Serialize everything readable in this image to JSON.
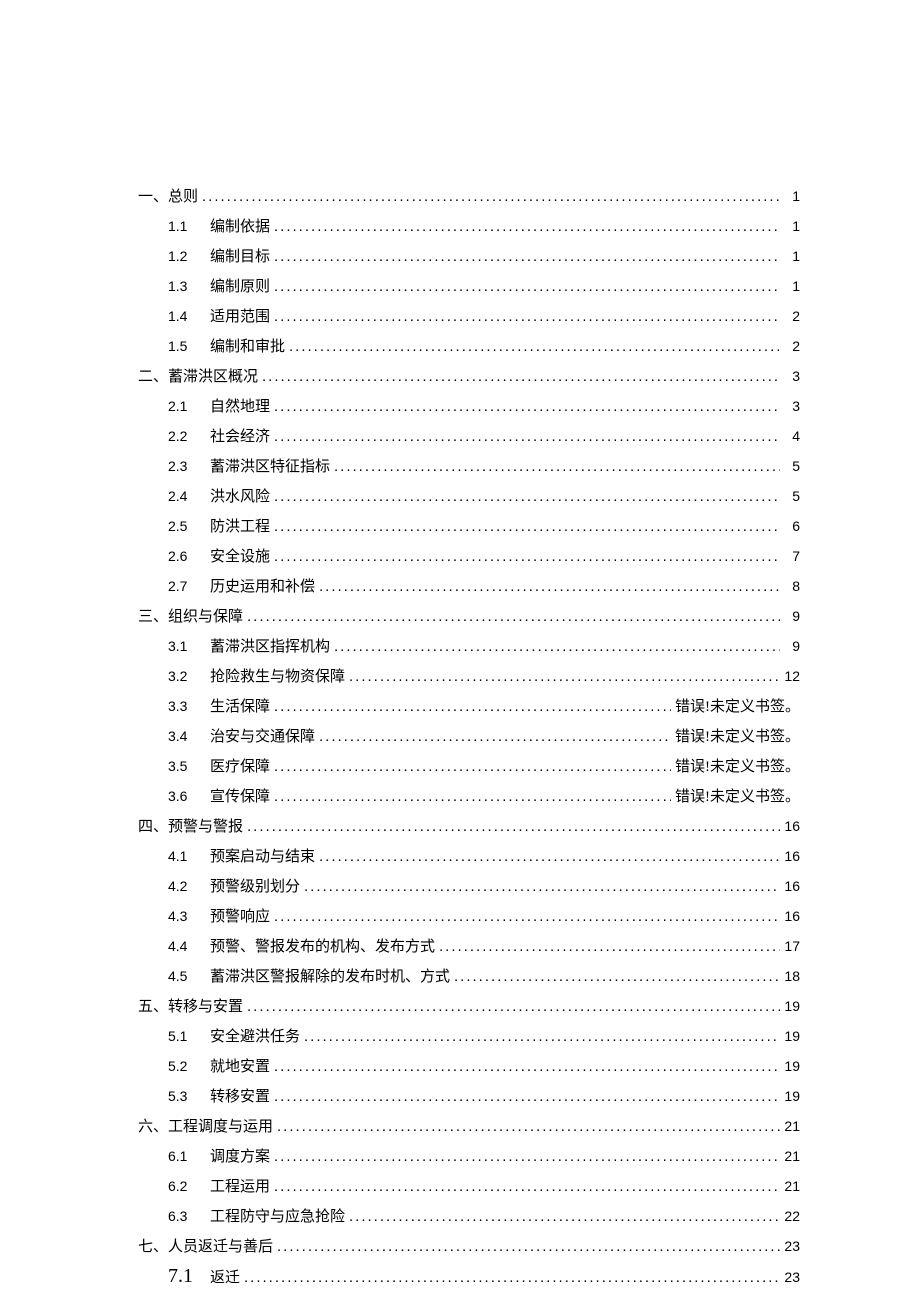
{
  "error_text": "错误!未定义书签。",
  "toc": [
    {
      "level": 1,
      "num": "",
      "title": "一、总则",
      "page": "1"
    },
    {
      "level": 2,
      "num": "1.1",
      "title": "编制依据",
      "page": "1"
    },
    {
      "level": 2,
      "num": "1.2",
      "title": "编制目标",
      "page": "1"
    },
    {
      "level": 2,
      "num": "1.3",
      "title": "编制原则",
      "page": "1"
    },
    {
      "level": 2,
      "num": "1.4",
      "title": "适用范围",
      "page": "2"
    },
    {
      "level": 2,
      "num": "1.5",
      "title": "编制和审批",
      "page": "2"
    },
    {
      "level": 1,
      "num": "",
      "title": "二、蓄滞洪区概况",
      "page": "3"
    },
    {
      "level": 2,
      "num": "2.1",
      "title": "自然地理",
      "page": "3"
    },
    {
      "level": 2,
      "num": "2.2",
      "title": "社会经济",
      "page": "4"
    },
    {
      "level": 2,
      "num": "2.3",
      "title": "蓄滞洪区特征指标",
      "page": "5"
    },
    {
      "level": 2,
      "num": "2.4",
      "title": "洪水风险",
      "page": "5"
    },
    {
      "level": 2,
      "num": "2.5",
      "title": "防洪工程",
      "page": "6"
    },
    {
      "level": 2,
      "num": "2.6",
      "title": "安全设施",
      "page": "7"
    },
    {
      "level": 2,
      "num": "2.7",
      "title": "历史运用和补偿",
      "page": "8"
    },
    {
      "level": 1,
      "num": "",
      "title": "三、组织与保障",
      "page": "9"
    },
    {
      "level": 2,
      "num": "3.1",
      "title": "蓄滞洪区指挥机构",
      "page": "9"
    },
    {
      "level": 2,
      "num": "3.2",
      "title": "抢险救生与物资保障",
      "page": "12"
    },
    {
      "level": 2,
      "num": "3.3",
      "title": "生活保障",
      "page": "ERR"
    },
    {
      "level": 2,
      "num": "3.4",
      "title": "治安与交通保障",
      "page": "ERR"
    },
    {
      "level": 2,
      "num": "3.5",
      "title": "医疗保障",
      "page": "ERR"
    },
    {
      "level": 2,
      "num": "3.6",
      "title": "宣传保障",
      "page": "ERR"
    },
    {
      "level": 1,
      "num": "",
      "title": "四、预警与警报",
      "page": "16"
    },
    {
      "level": 2,
      "num": "4.1",
      "title": "预案启动与结束",
      "page": "16"
    },
    {
      "level": 2,
      "num": "4.2",
      "title": "预警级别划分",
      "page": "16"
    },
    {
      "level": 2,
      "num": "4.3",
      "title": "预警响应",
      "page": "16"
    },
    {
      "level": 2,
      "num": "4.4",
      "title": "预警、警报发布的机构、发布方式",
      "page": "17"
    },
    {
      "level": 2,
      "num": "4.5",
      "title": "蓄滞洪区警报解除的发布时机、方式",
      "page": "18"
    },
    {
      "level": 1,
      "num": "",
      "title": "五、转移与安置",
      "page": "19"
    },
    {
      "level": 2,
      "num": "5.1",
      "title": "安全避洪任务",
      "page": "19"
    },
    {
      "level": 2,
      "num": "5.2",
      "title": "就地安置",
      "page": "19"
    },
    {
      "level": 2,
      "num": "5.3",
      "title": "转移安置",
      "page": "19"
    },
    {
      "level": 1,
      "num": "",
      "title": "六、工程调度与运用",
      "page": "21"
    },
    {
      "level": 2,
      "num": "6.1",
      "title": "调度方案",
      "page": "21"
    },
    {
      "level": 2,
      "num": "6.2",
      "title": "工程运用",
      "page": "21"
    },
    {
      "level": 2,
      "num": "6.3",
      "title": "工程防守与应急抢险",
      "page": "22"
    },
    {
      "level": 1,
      "num": "",
      "title": "七、人员返迁与善后",
      "page": "23"
    },
    {
      "level": 2,
      "num": "7.1",
      "title": "返迁",
      "page": "23",
      "large_num": true
    }
  ]
}
